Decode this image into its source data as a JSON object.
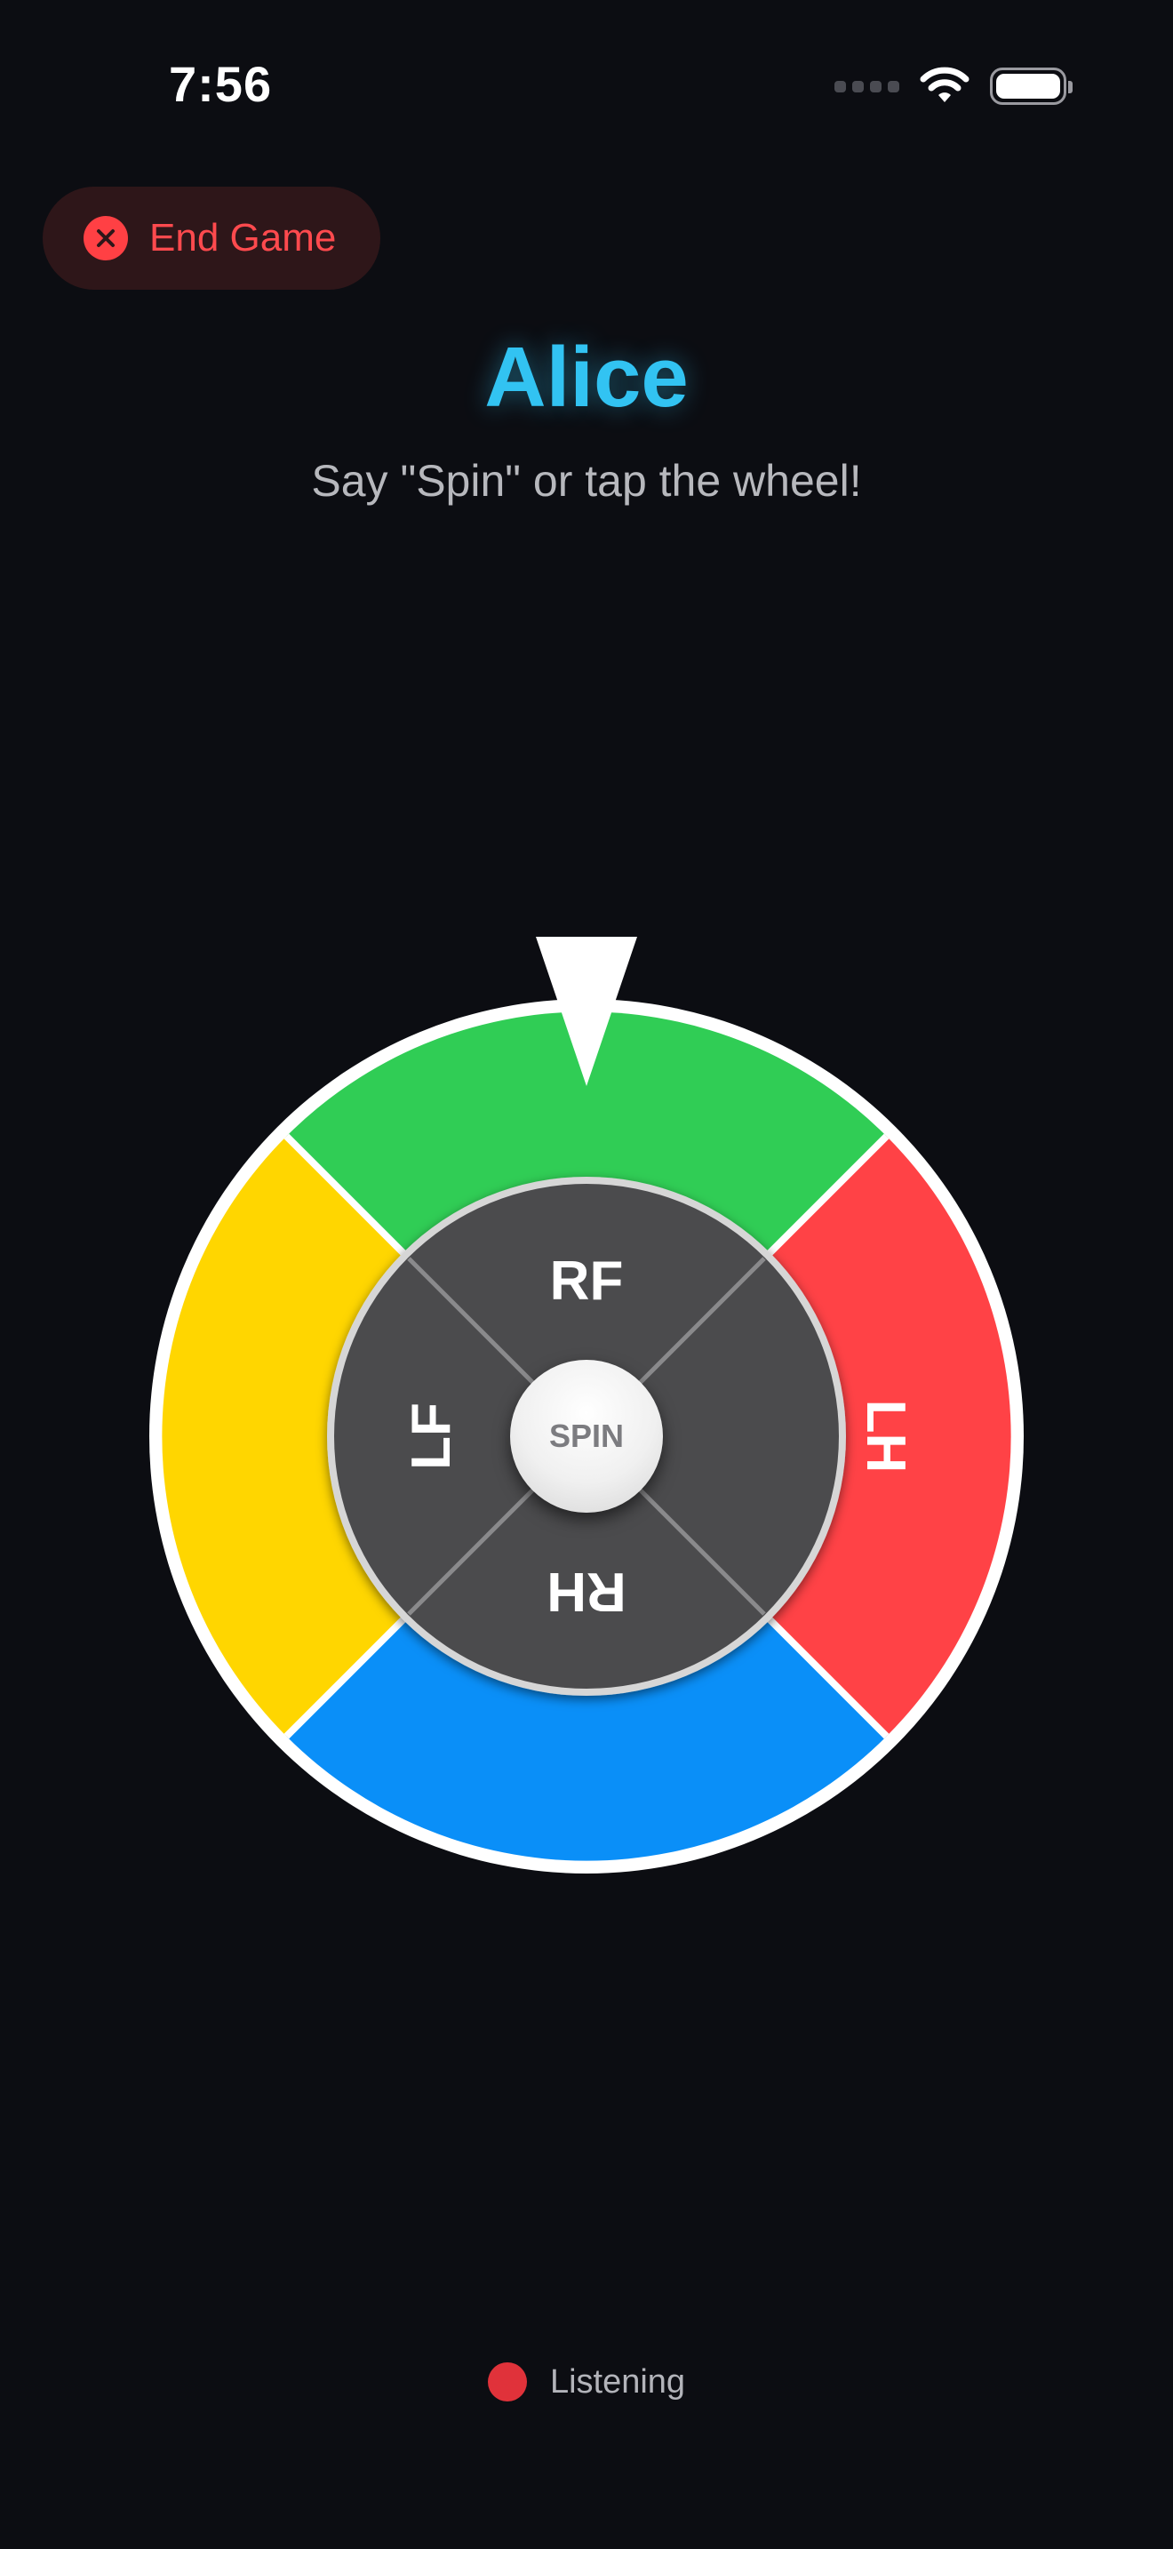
{
  "status_bar": {
    "time": "7:56",
    "icons": [
      "cellular-signal-icon",
      "wifi-icon",
      "battery-icon"
    ]
  },
  "end_game": {
    "label": "End Game",
    "icon": "close-circle-icon",
    "color": "#ff4a4e"
  },
  "player": {
    "name": "Alice",
    "name_color": "#32c3f2"
  },
  "instruction": "Say \"Spin\" or tap the wheel!",
  "wheel": {
    "outer_segments": [
      {
        "color_name": "green",
        "color": "#30cd55"
      },
      {
        "color_name": "red",
        "color": "#ff4246"
      },
      {
        "color_name": "blue",
        "color": "#0a8ff8"
      },
      {
        "color_name": "yellow",
        "color": "#ffd600"
      }
    ],
    "inner_labels": {
      "top": "RF",
      "right": "LH",
      "bottom": "RH",
      "left": "LF"
    },
    "spin_label": "SPIN",
    "pointer": "pointer-triangle-icon"
  },
  "listening": {
    "label": "Listening",
    "indicator_color": "#e0323a"
  }
}
